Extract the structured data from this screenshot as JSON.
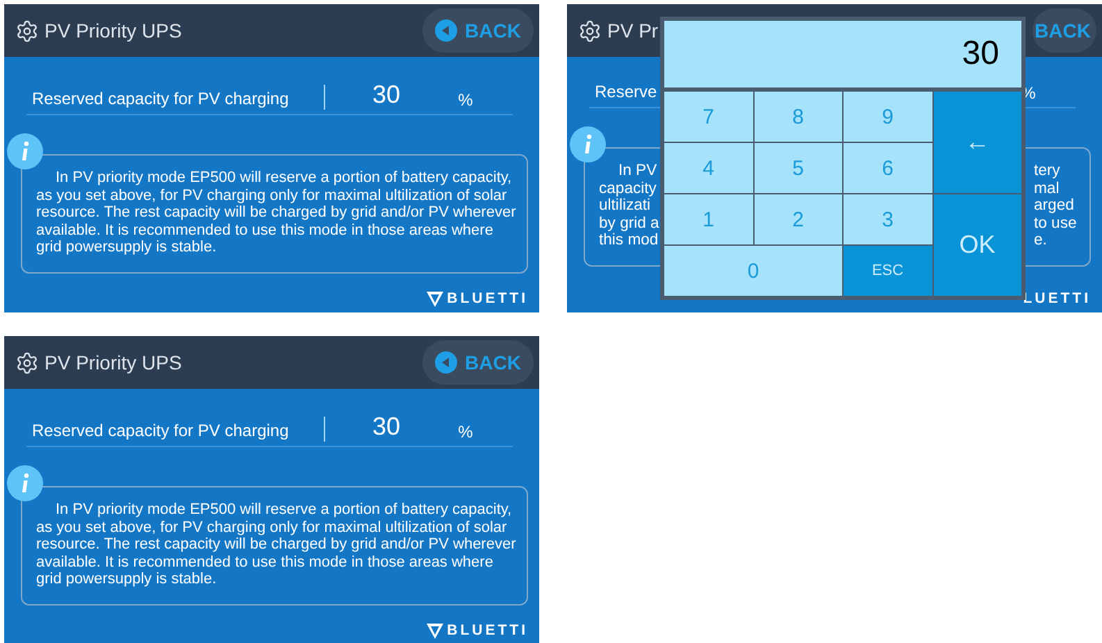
{
  "screens": [
    {
      "kind": "settings",
      "title": "PV Priority UPS",
      "back": "BACK",
      "setting": {
        "label": "Reserved capacity for PV charging",
        "value": "30",
        "unit": "%"
      },
      "info": "In PV priority mode EP500 will reserve a portion of battery capacity, as you set above, for PV charging only for maximal ultilization of solar resource. The rest capacity will be charged by grid and/or PV wherever available. It is recommended to use this mode in those areas where grid powersupply is stable.",
      "logo": "BLUETTI"
    },
    {
      "kind": "keypad",
      "title": "PV Pr",
      "back": "BACK",
      "setting": {
        "label": "Reserve",
        "unit": "%"
      },
      "info_left": [
        "In PV",
        "capacity",
        "ultilizati",
        "by grid a",
        "this mod"
      ],
      "info_right": [
        "tery",
        "mal",
        "arged",
        "to use",
        "e."
      ],
      "logo": "LUETTI",
      "keypad": {
        "display": "30",
        "keys": [
          {
            "label": "7",
            "kind": "digit"
          },
          {
            "label": "8",
            "kind": "digit"
          },
          {
            "label": "9",
            "kind": "digit"
          },
          {
            "label": "←",
            "kind": "tall"
          },
          {
            "label": "4",
            "kind": "digit"
          },
          {
            "label": "5",
            "kind": "digit"
          },
          {
            "label": "6",
            "kind": "digit"
          },
          {
            "label": "1",
            "kind": "digit"
          },
          {
            "label": "2",
            "kind": "digit"
          },
          {
            "label": "3",
            "kind": "digit"
          },
          {
            "label": "OK",
            "kind": "tall"
          },
          {
            "label": "0",
            "kind": "wide"
          },
          {
            "label": "ESC",
            "kind": "esc"
          }
        ]
      }
    },
    {
      "kind": "settings",
      "title": "PV Priority UPS",
      "back": "BACK",
      "setting": {
        "label": "Reserved capacity for PV charging",
        "value": "30",
        "unit": "%"
      },
      "info": "In PV priority mode EP500 will reserve a portion of battery capacity, as you set above, for PV charging only for maximal ultilization of solar resource. The rest capacity will be charged by grid and/or PV wherever available. It is recommended to use this mode in those areas where grid powersupply is stable.",
      "logo": "BLUETTI"
    }
  ]
}
